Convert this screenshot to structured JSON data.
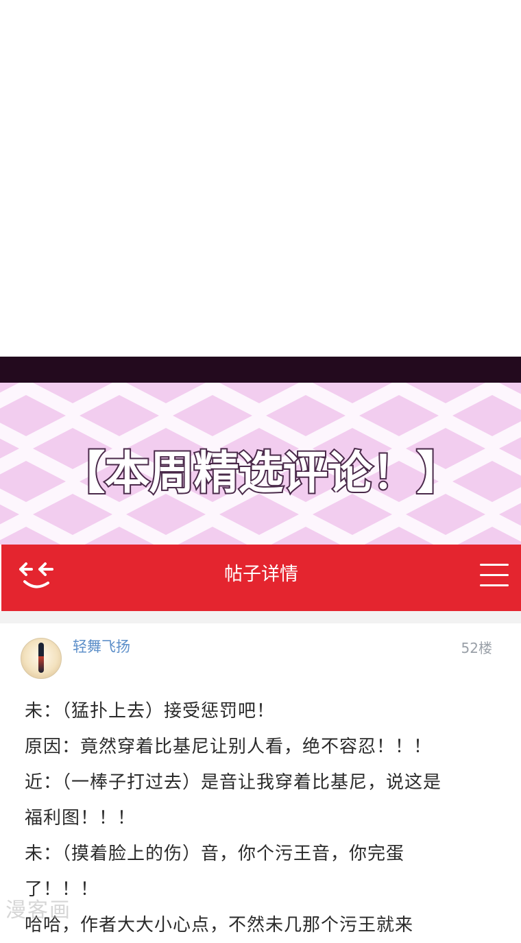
{
  "banner": {
    "title": "【本周精选评论！】"
  },
  "header": {
    "title": "帖子详情",
    "back_icon": "back-arrows-icon",
    "menu_icon": "hamburger-menu-icon",
    "bg_color": "#e4252f"
  },
  "post": {
    "username": "轻舞飞扬",
    "floor": "52楼",
    "lines": [
      "未：（猛扑上去）接受惩罚吧！",
      "原因：竟然穿着比基尼让别人看，绝不容忍！！！",
      "近：（一棒子打过去）是音让我穿着比基尼，说这是",
      "福利图！！！",
      "未：（摸着脸上的伤）音，你个污王音，你完蛋",
      "了！！！",
      "哈哈，作者大大小心点，不然未几那个污王就来"
    ]
  },
  "watermark": "漫客画"
}
